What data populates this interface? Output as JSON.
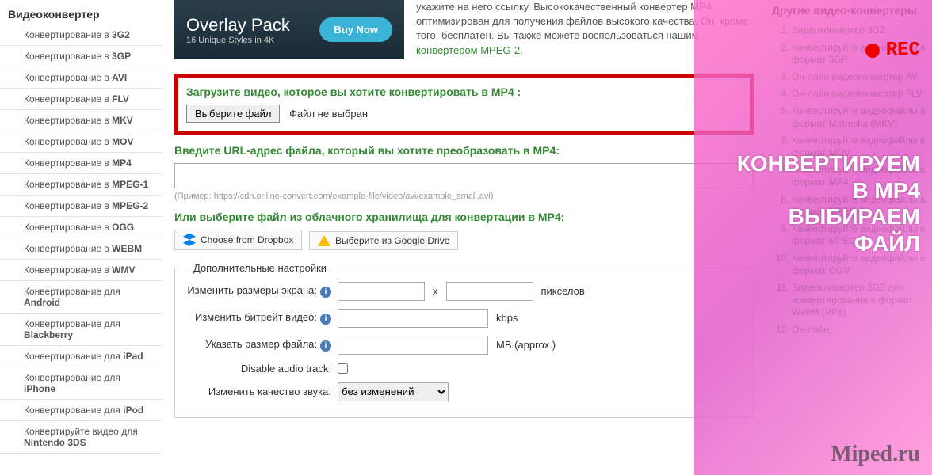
{
  "sidebar_left": {
    "title": "Видеоконвертер",
    "items": [
      {
        "prefix": "Конвертирование в",
        "fmt": "3G2"
      },
      {
        "prefix": "Конвертирование в",
        "fmt": "3GP"
      },
      {
        "prefix": "Конвертирование в",
        "fmt": "AVI"
      },
      {
        "prefix": "Конвертирование в",
        "fmt": "FLV"
      },
      {
        "prefix": "Конвертирование в",
        "fmt": "MKV"
      },
      {
        "prefix": "Конвертирование в",
        "fmt": "MOV"
      },
      {
        "prefix": "Конвертирование в",
        "fmt": "MP4"
      },
      {
        "prefix": "Конвертирование в",
        "fmt": "MPEG-1"
      },
      {
        "prefix": "Конвертирование в",
        "fmt": "MPEG-2"
      },
      {
        "prefix": "Конвертирование в",
        "fmt": "OGG"
      },
      {
        "prefix": "Конвертирование в",
        "fmt": "WEBM"
      },
      {
        "prefix": "Конвертирование в",
        "fmt": "WMV"
      },
      {
        "prefix": "Конвертирование для",
        "fmt": "Android"
      },
      {
        "prefix": "Конвертирование для",
        "fmt": "Blackberry"
      },
      {
        "prefix": "Конвертирование для",
        "fmt": "iPad"
      },
      {
        "prefix": "Конвертирование для",
        "fmt": "iPhone"
      },
      {
        "prefix": "Конвертирование для",
        "fmt": "iPod"
      },
      {
        "prefix": "Конвертируйте видео для",
        "fmt": "Nintendo 3DS"
      }
    ]
  },
  "banner": {
    "title": "Overlay Pack",
    "sub": "16 Unique Styles in 4K",
    "btn": "Buy Now"
  },
  "desc": {
    "text": "укажите на него ссылку. Высококачественный конвертер MP4 оптимизирован для получения файлов высокого качества. Он, кроме того, бесплатен. Вы также можете воспользоваться нашим ",
    "link": "конвертером MPEG-2",
    "tail": "."
  },
  "upload": {
    "title": "Загрузите видео, которое вы хотите конвертировать в MP4 :",
    "choose": "Выберите файл",
    "status": "Файл не выбран"
  },
  "url": {
    "title": "Введите URL-адрес файла, который вы хотите преобразовать в MP4:",
    "hint": "(Пример: https://cdn.online-convert.com/example-file/video/avi/example_small.avi)"
  },
  "cloud": {
    "title": "Или выберите файл из облачного хранилища для конвертации в MP4:",
    "dropbox": "Choose from Dropbox",
    "gdrive": "Выберите из Google Drive"
  },
  "settings": {
    "legend": "Дополнительные настройки",
    "screen": "Изменить размеры экрана:",
    "x": "x",
    "px": "пикселов",
    "bitrate": "Изменить битрейт видео:",
    "kbps": "kbps",
    "filesize": "Указать размер файла:",
    "mb": "MB (approx.)",
    "disable_audio": "Disable audio track:",
    "audio_quality": "Изменить качество звука:",
    "audio_select": "без изменений"
  },
  "sidebar_right": {
    "title": "Другие видео-конвертеры",
    "items": [
      "Видеоконвертер 3G2",
      "Конвертируйте видеофайлы в формат 3GP",
      "Он-лайн видеоконвертер AVI",
      "Он-лайн видеоконвертер FLV",
      "Конвертируйте видеофайлы в формат Matroska (MKV)",
      "Конвертируйте видеофайлы в формат MOV",
      "Конвертируйте видеофайлы в формат MP4",
      "Конвертируйте видеофайлы в формат MPEG-1",
      "Конвертируйте видеофайлы в формат MPEG-2",
      "Конвертируйте видеофайлы в формат OGV",
      "Видеоконвертер 3G2 для конвертирования в формат WebM (VP8)",
      "Он-лайн"
    ]
  },
  "overlay": {
    "rec": "REC",
    "line1": "КОНВЕРТИРУЕМ",
    "line2": "В MP4",
    "line3": "ВЫБИРАЕМ",
    "line4": "ФАЙЛ"
  },
  "watermark": "Miped.ru"
}
